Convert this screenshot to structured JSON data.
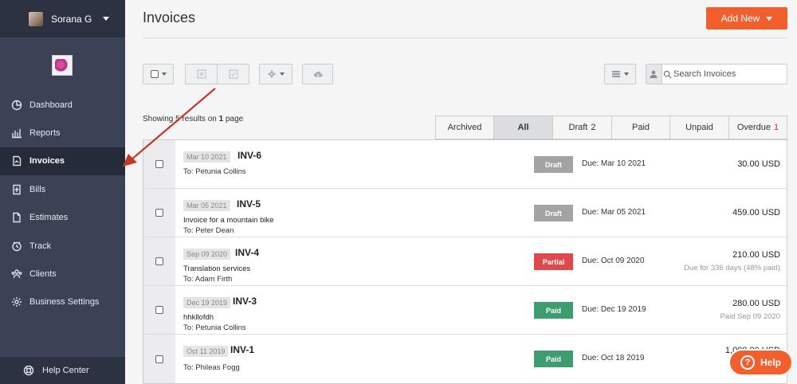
{
  "sidebar": {
    "username": "Sorana G",
    "items": [
      {
        "label": "Dashboard"
      },
      {
        "label": "Reports"
      },
      {
        "label": "Invoices"
      },
      {
        "label": "Bills"
      },
      {
        "label": "Estimates"
      },
      {
        "label": "Track"
      },
      {
        "label": "Clients"
      },
      {
        "label": "Business Settings"
      }
    ],
    "active": "Invoices",
    "help_center": "Help Center"
  },
  "header": {
    "title": "Invoices",
    "add_new_label": "Add New"
  },
  "search": {
    "placeholder": "Search Invoices",
    "value": ""
  },
  "list_info": {
    "prefix": "Showing ",
    "count": "5",
    "middle": " results on ",
    "pages": "1",
    "suffix": " page"
  },
  "tabs": [
    {
      "label": "Archived",
      "count": ""
    },
    {
      "label": "All",
      "count": ""
    },
    {
      "label": "Draft",
      "count": "2"
    },
    {
      "label": "Paid",
      "count": ""
    },
    {
      "label": "Unpaid",
      "count": ""
    },
    {
      "label": "Overdue",
      "count": "1"
    }
  ],
  "active_tab": "All",
  "invoices": [
    {
      "date": "Mar 10 2021",
      "number": "INV-6",
      "description": "",
      "to": "To: Petunia Collins",
      "status": "Draft",
      "due": "Due: Mar 10 2021",
      "amount": "30.00 USD",
      "sub": ""
    },
    {
      "date": "Mar 05 2021",
      "number": "INV-5",
      "description": "Invoice for a mountain bike",
      "to": "To: Peter Dean",
      "status": "Draft",
      "due": "Due: Mar 05 2021",
      "amount": "459.00 USD",
      "sub": ""
    },
    {
      "date": "Sep 09 2020",
      "number": "INV-4",
      "description": "Translation services",
      "to": "To: Adam Firth",
      "status": "Partial",
      "due": "Due: Oct 09 2020",
      "amount": "210.00 USD",
      "sub": "Due for 336 days (48% paid)"
    },
    {
      "date": "Dec 19 2019",
      "number": "INV-3",
      "description": "hhkllofdh",
      "to": "To: Petunia Collins",
      "status": "Paid",
      "due": "Due: Dec 19 2019",
      "amount": "280.00 USD",
      "sub": "Paid Sep 09 2020"
    },
    {
      "date": "Oct 11 2019",
      "number": "INV-1",
      "description": "",
      "to": "To: Phileas Fogg",
      "status": "Paid",
      "due": "Due: Oct 18 2019",
      "amount": "1,000.00 USD",
      "sub": ""
    }
  ],
  "status_colors": {
    "Draft": "#a3a3a3",
    "Partial": "#e0484b",
    "Paid": "#3e9c71"
  },
  "colors": {
    "sidebar": "#3c4255",
    "accent": "#f1602c"
  },
  "help_button": "Help"
}
